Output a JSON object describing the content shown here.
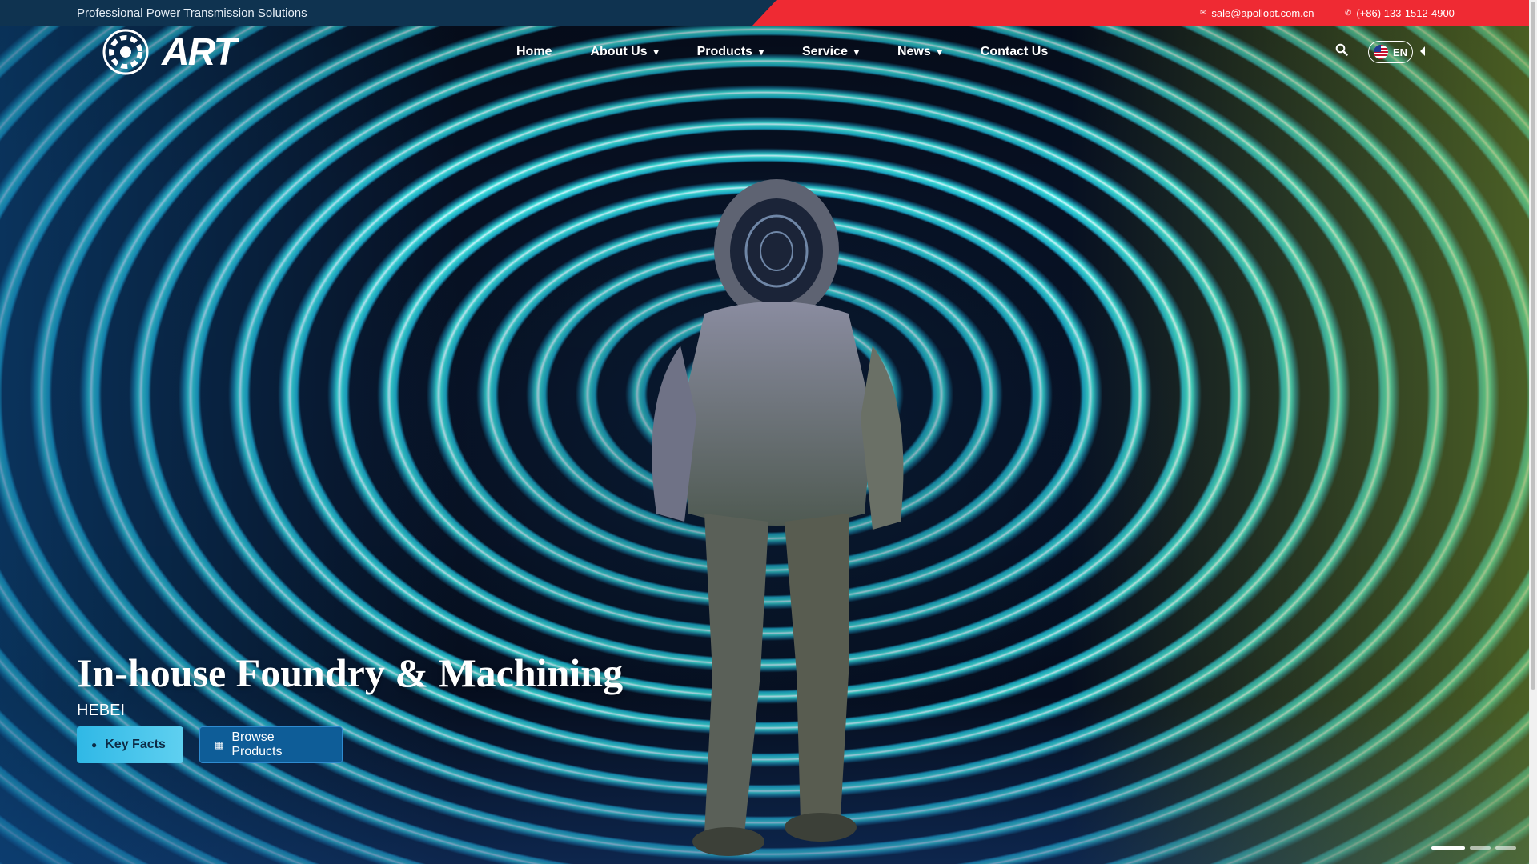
{
  "topbar": {
    "tagline": "Professional Power Transmission Solutions",
    "email": "sale@apollopt.com.cn",
    "phone": "(+86) 133-1512-4900"
  },
  "header": {
    "logo_text": "ART",
    "nav": [
      {
        "label": "Home",
        "has_dropdown": false
      },
      {
        "label": "About Us",
        "has_dropdown": true
      },
      {
        "label": "Products",
        "has_dropdown": true
      },
      {
        "label": "Service",
        "has_dropdown": true
      },
      {
        "label": "News",
        "has_dropdown": true
      },
      {
        "label": "Contact Us",
        "has_dropdown": false
      }
    ],
    "language": "EN"
  },
  "hero": {
    "title": "In-house Foundry & Machining",
    "subtitle": "HEBEI",
    "buttons": {
      "key_facts": "Key Facts",
      "browse_products": "Browse Products"
    },
    "slides_total": 3,
    "active_slide": 1
  },
  "colors": {
    "topbar_bg": "#0f3350",
    "topbar_accent": "#ef2a33",
    "key_facts_btn": "#2fb8e6",
    "browse_btn": "#0e5d98"
  }
}
